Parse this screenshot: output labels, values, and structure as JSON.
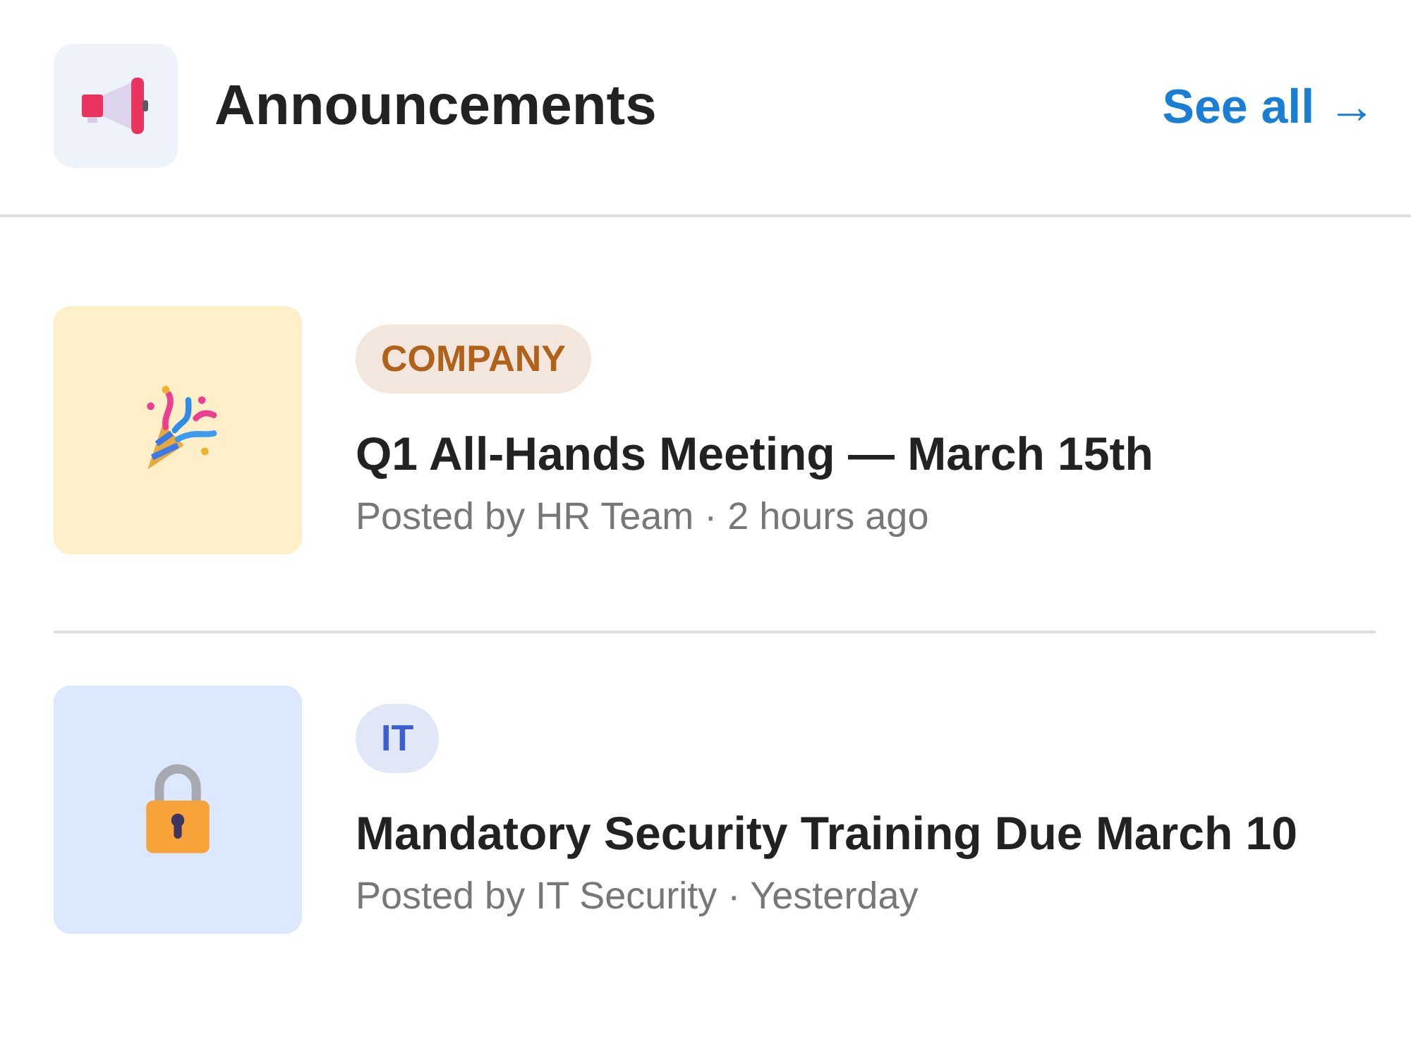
{
  "header": {
    "title": "Announcements",
    "link": "See all →"
  },
  "announcements": [
    {
      "kind": "party",
      "tag": "COMPANY",
      "color": "#b0611a",
      "title": "Q1 All-Hands Meeting — March 15th",
      "meta": "Posted by HR Team · 2 hours ago"
    },
    {
      "kind": "lock",
      "tag": "IT",
      "color": "#3b5fd0",
      "title": "Mandatory Security Training Due March 10",
      "meta": "Posted by IT Security · Yesterday"
    }
  ]
}
